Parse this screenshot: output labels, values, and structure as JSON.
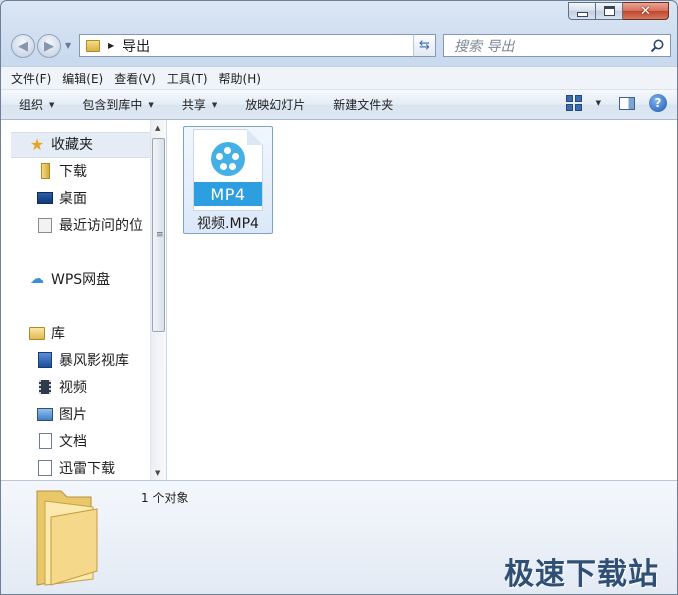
{
  "window": {
    "caption_buttons": {
      "minimize": "minimize",
      "maximize": "maximize",
      "close": "close"
    }
  },
  "navbar": {
    "address_text": "导出",
    "search_placeholder": "搜索 导出"
  },
  "menubar": [
    "文件(F)",
    "编辑(E)",
    "查看(V)",
    "工具(T)",
    "帮助(H)"
  ],
  "toolbar": {
    "organize": "组织",
    "include_in_library": "包含到库中",
    "share": "共享",
    "slideshow": "放映幻灯片",
    "new_folder": "新建文件夹"
  },
  "sidebar": {
    "favorites": "收藏夹",
    "downloads": "下载",
    "desktop": "桌面",
    "recent": "最近访问的位",
    "wps_cloud": "WPS网盘",
    "libraries": "库",
    "baofeng": "暴风影视库",
    "videos": "视频",
    "pictures": "图片",
    "documents": "文档",
    "xunlei": "迅雷下载"
  },
  "files": [
    {
      "badge": "MP4",
      "name": "视频.MP4"
    }
  ],
  "details": {
    "count": "1 个对象"
  },
  "watermark": "极速下载站",
  "colors": {
    "accent": "#2d9fe0",
    "window_frame": "#c9d9ee",
    "close_button": "#c2452c"
  }
}
